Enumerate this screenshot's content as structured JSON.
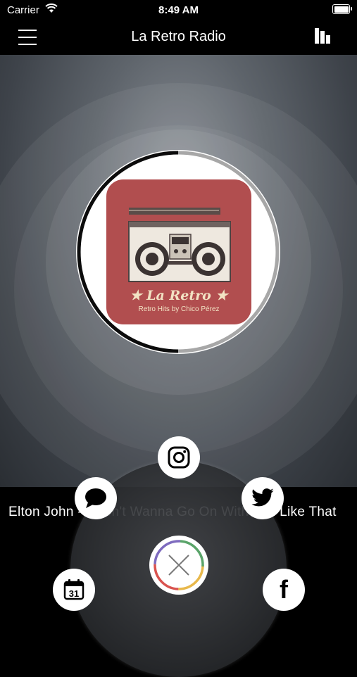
{
  "status_bar": {
    "carrier": "Carrier",
    "time": "8:49 AM"
  },
  "nav": {
    "title": "La Retro Radio",
    "menu_icon": "hamburger-menu-icon",
    "equalizer_icon": "equalizer-icon"
  },
  "station": {
    "logo_title": "★ La Retro ★",
    "logo_subtitle": "Retro Hits by Chico Pérez",
    "logo_colors": {
      "background": "#b14e4f",
      "title": "#f2e3c4"
    }
  },
  "now_playing": {
    "text": "Elton John - I Don't Wanna Go On With You Like That"
  },
  "share_menu": {
    "items": [
      {
        "name": "instagram",
        "icon": "instagram-icon"
      },
      {
        "name": "sms",
        "icon": "chat-bubble-icon"
      },
      {
        "name": "twitter",
        "icon": "twitter-bird-icon",
        "color": "#000000"
      },
      {
        "name": "calendar",
        "icon": "calendar-icon",
        "label": "31"
      },
      {
        "name": "facebook",
        "icon": "facebook-icon",
        "label": "f"
      }
    ],
    "close_icon": "close-x-icon"
  }
}
